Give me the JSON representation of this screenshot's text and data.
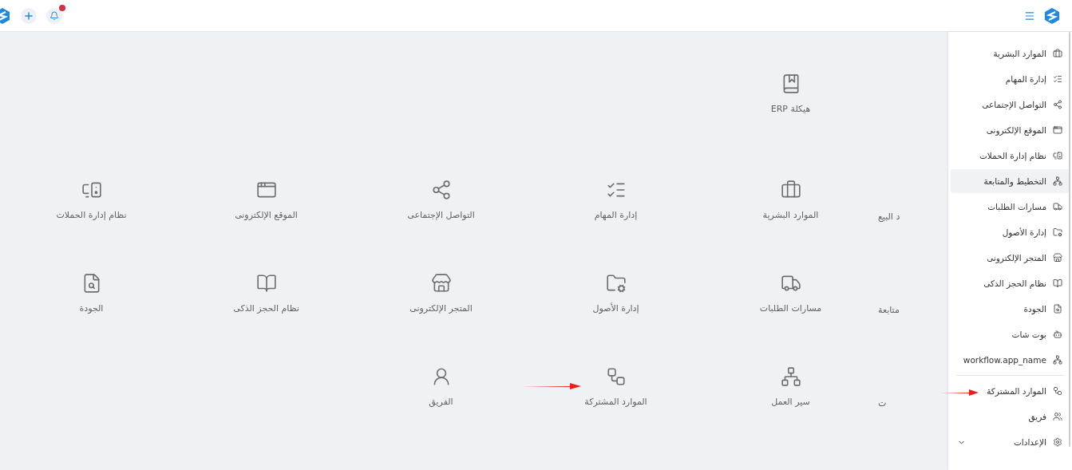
{
  "header": {
    "notification_badge": true
  },
  "apps": {
    "rows": [
      {
        "edge_label": null,
        "items": [
          {
            "label": "هيكلة ERP"
          }
        ]
      },
      {
        "edge_label": "د البيع",
        "items": [
          {
            "label": "الموارد البشرية"
          },
          {
            "label": "إدارة المهام"
          },
          {
            "label": "التواصل الإجتماعى"
          },
          {
            "label": "الموقع الإلكترونى"
          },
          {
            "label": "نظام إدارة الحملات"
          }
        ]
      },
      {
        "edge_label": "متابعة",
        "items": [
          {
            "label": "مسارات الطلبات"
          },
          {
            "label": "إدارة الأصول"
          },
          {
            "label": "المتجر الإلكترونى"
          },
          {
            "label": "نظام الحجز الذكى"
          },
          {
            "label": "الجودة"
          }
        ]
      },
      {
        "edge_label": "ت",
        "items": [
          {
            "label": "سير العمل"
          },
          {
            "label": "الموارد المشتركة"
          },
          {
            "label": "الفريق"
          }
        ]
      }
    ]
  },
  "sidebar": {
    "items": [
      {
        "label": "الموارد البشرية",
        "selected": false
      },
      {
        "label": "إدارة المهام",
        "selected": false
      },
      {
        "label": "التواصل الإجتماعى",
        "selected": false
      },
      {
        "label": "الموقع الإلكترونى",
        "selected": false
      },
      {
        "label": "نظام إدارة الحملات",
        "selected": false
      },
      {
        "label": "التخطيط والمتابعة",
        "selected": true
      },
      {
        "label": "مسارات الطلبات",
        "selected": false
      },
      {
        "label": "إدارة الأصول",
        "selected": false
      },
      {
        "label": "المتجر الإلكترونى",
        "selected": false
      },
      {
        "label": "نظام الحجز الذكى",
        "selected": false
      },
      {
        "label": "الجودة",
        "selected": false
      },
      {
        "label": "بوت شات",
        "selected": false
      },
      {
        "label": "workflow.app_name",
        "selected": false
      }
    ],
    "bottom_items": [
      {
        "label": "الموارد المشتركة",
        "expandable": false
      },
      {
        "label": "فريق",
        "expandable": false
      },
      {
        "label": "الإعدادات",
        "expandable": true
      }
    ]
  }
}
